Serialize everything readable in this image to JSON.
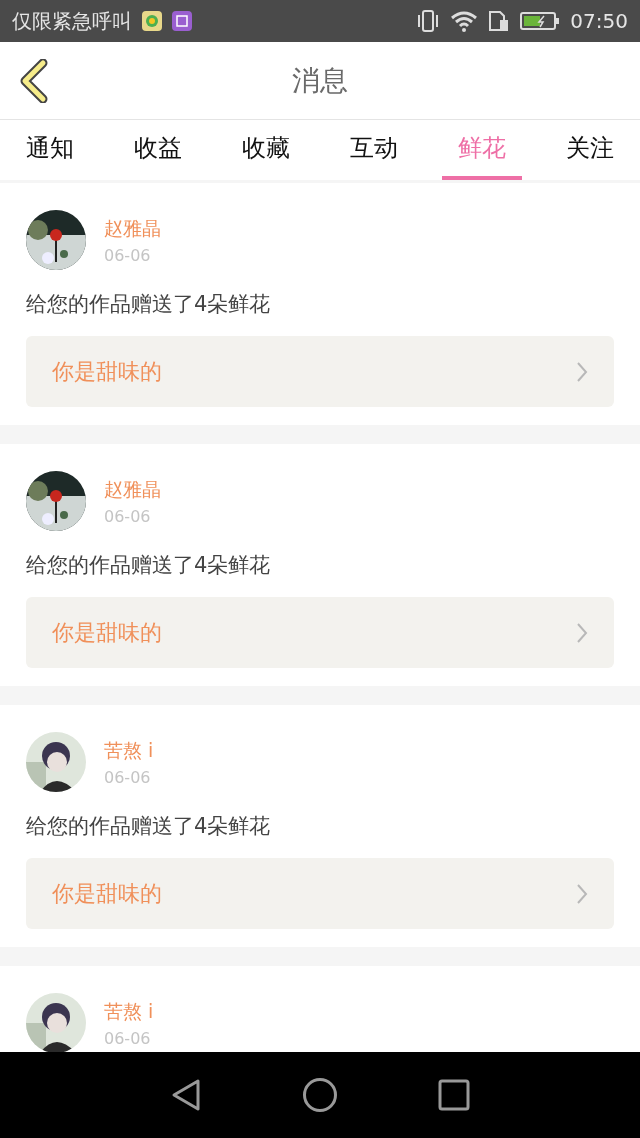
{
  "status_bar": {
    "carrier": "仅限紧急呼叫",
    "time": "07:50"
  },
  "header": {
    "title": "消息"
  },
  "tabs": [
    {
      "label": "通知",
      "selected": false
    },
    {
      "label": "收益",
      "selected": false
    },
    {
      "label": "收藏",
      "selected": false
    },
    {
      "label": "互动",
      "selected": false
    },
    {
      "label": "鲜花",
      "selected": true
    },
    {
      "label": "关注",
      "selected": false
    }
  ],
  "messages": [
    {
      "name": "赵雅晶",
      "date": "06-06",
      "text": "给您的作品赠送了4朵鲜花",
      "work": "你是甜味的"
    },
    {
      "name": "赵雅晶",
      "date": "06-06",
      "text": "给您的作品赠送了4朵鲜花",
      "work": "你是甜味的"
    },
    {
      "name": "苦熬 i",
      "date": "06-06",
      "text": "给您的作品赠送了4朵鲜花",
      "work": "你是甜味的"
    },
    {
      "name": "苦熬 i",
      "date": "06-06"
    }
  ]
}
